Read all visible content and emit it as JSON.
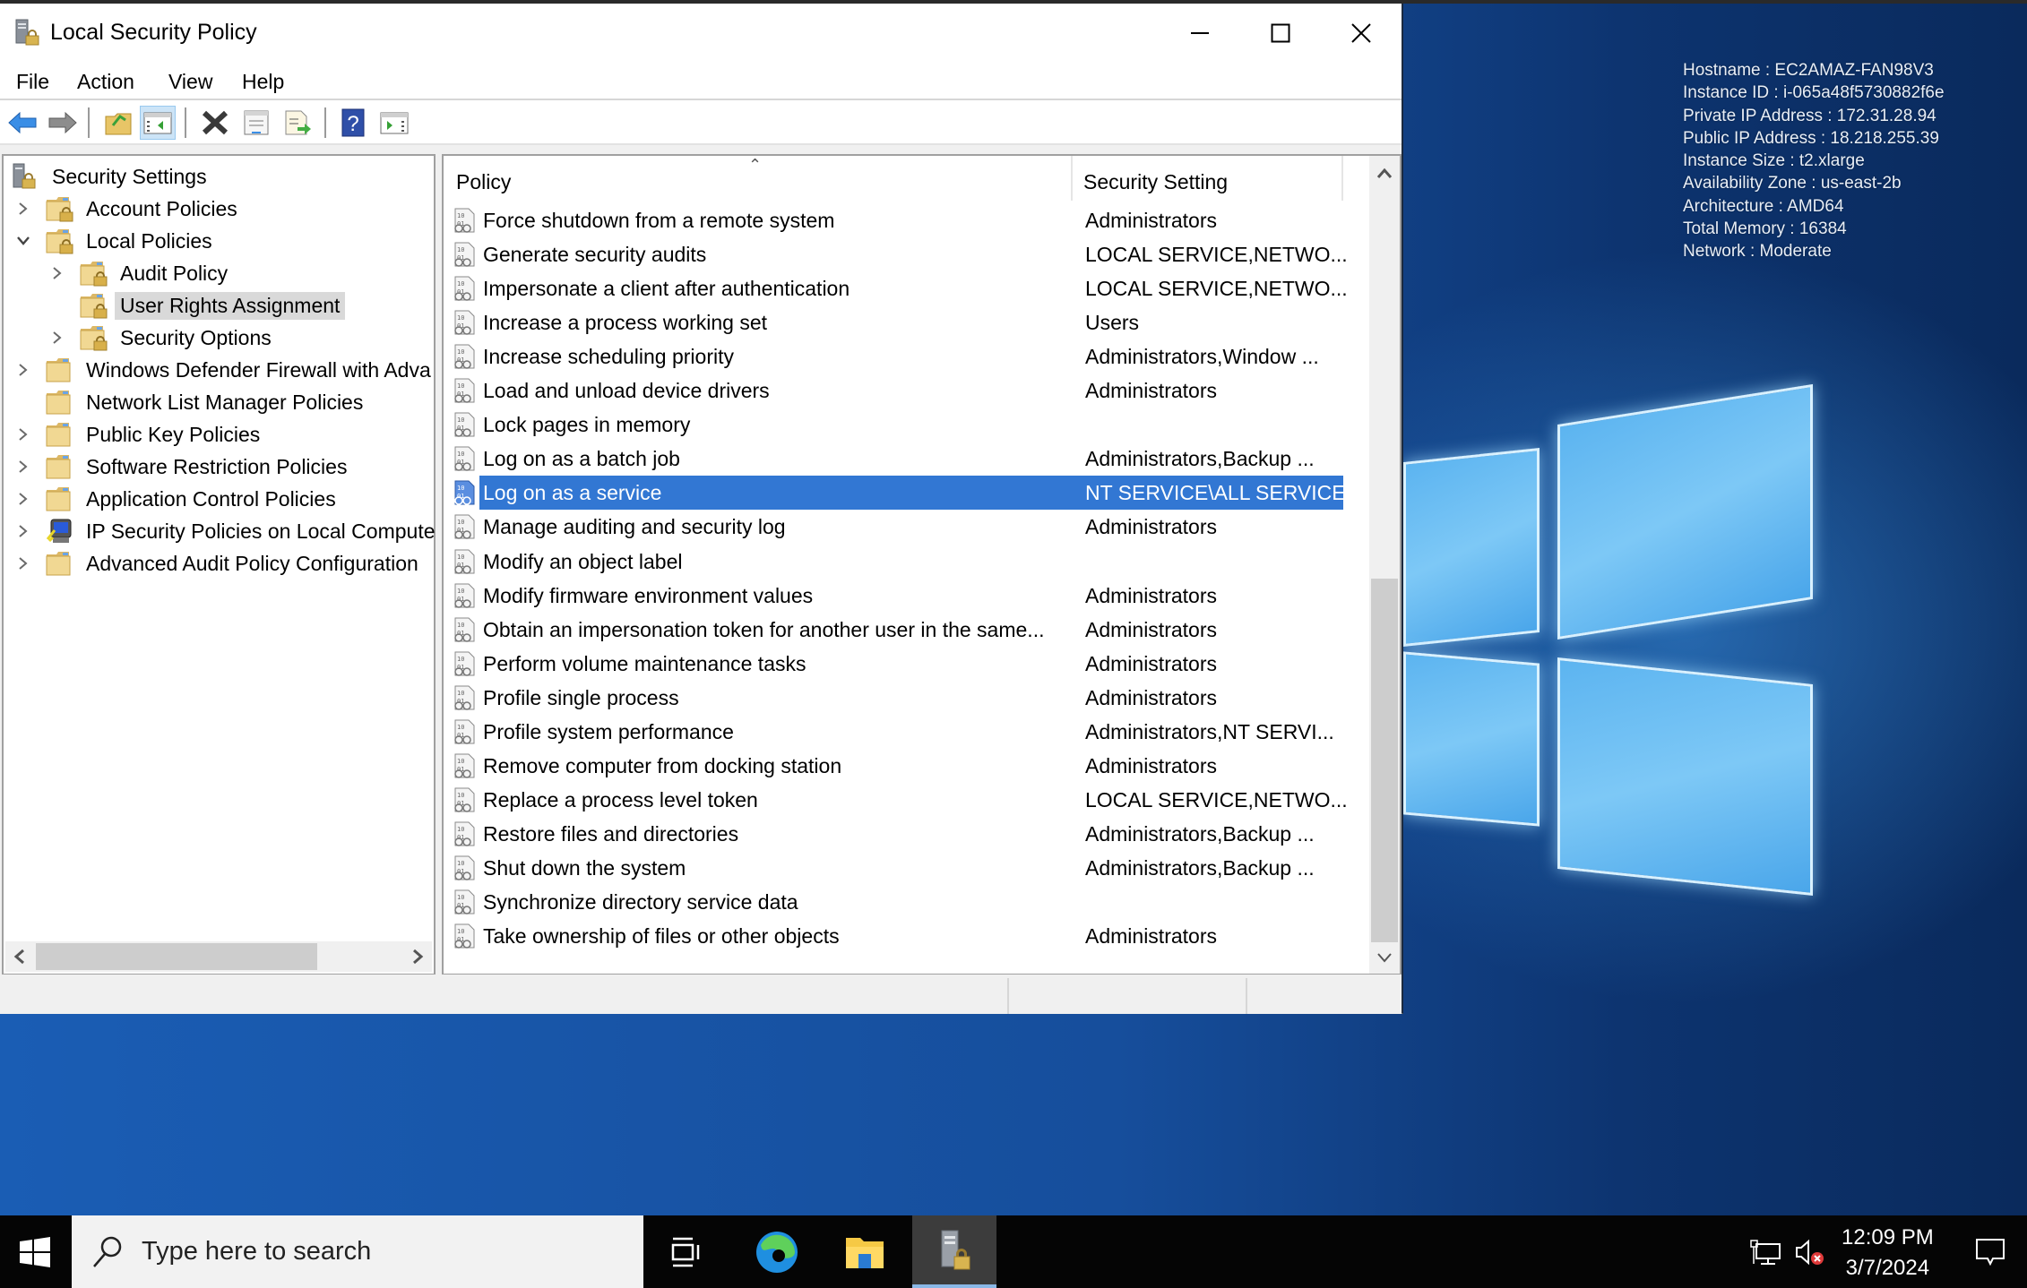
{
  "window": {
    "title": "Local Security Policy",
    "caption_buttons": [
      "minimize",
      "maximize",
      "close"
    ]
  },
  "menu": [
    "File",
    "Action",
    "View",
    "Help"
  ],
  "toolbar": {
    "buttons": [
      "back",
      "forward",
      "up-one-level",
      "show-hide-console-tree",
      "delete",
      "properties",
      "export-list",
      "help",
      "show-hide-action-pane"
    ]
  },
  "tree": {
    "root": "Security Settings",
    "items": [
      {
        "label": "Account Policies",
        "level": 1,
        "expander": "collapsed",
        "icon": "lock-folder"
      },
      {
        "label": "Local Policies",
        "level": 1,
        "expander": "expanded",
        "icon": "lock-folder"
      },
      {
        "label": "Audit Policy",
        "level": 2,
        "expander": "collapsed",
        "icon": "lock-folder"
      },
      {
        "label": "User Rights Assignment",
        "level": 2,
        "expander": "none",
        "icon": "lock-folder",
        "selected": true
      },
      {
        "label": "Security Options",
        "level": 2,
        "expander": "collapsed",
        "icon": "lock-folder"
      },
      {
        "label": "Windows Defender Firewall with Adva",
        "level": 1,
        "expander": "collapsed",
        "icon": "folder"
      },
      {
        "label": "Network List Manager Policies",
        "level": 1,
        "expander": "none",
        "icon": "folder"
      },
      {
        "label": "Public Key Policies",
        "level": 1,
        "expander": "collapsed",
        "icon": "folder"
      },
      {
        "label": "Software Restriction Policies",
        "level": 1,
        "expander": "collapsed",
        "icon": "folder"
      },
      {
        "label": "Application Control Policies",
        "level": 1,
        "expander": "collapsed",
        "icon": "folder"
      },
      {
        "label": "IP Security Policies on Local Compute",
        "level": 1,
        "expander": "collapsed",
        "icon": "ipsec"
      },
      {
        "label": "Advanced Audit Policy Configuration",
        "level": 1,
        "expander": "collapsed",
        "icon": "folder"
      }
    ]
  },
  "list": {
    "columns": [
      "Policy",
      "Security Setting"
    ],
    "sort_column": "Policy",
    "rows": [
      {
        "policy": "Force shutdown from a remote system",
        "setting": "Administrators"
      },
      {
        "policy": "Generate security audits",
        "setting": "LOCAL SERVICE,NETWO..."
      },
      {
        "policy": "Impersonate a client after authentication",
        "setting": "LOCAL SERVICE,NETWO..."
      },
      {
        "policy": "Increase a process working set",
        "setting": "Users"
      },
      {
        "policy": "Increase scheduling priority",
        "setting": "Administrators,Window ..."
      },
      {
        "policy": "Load and unload device drivers",
        "setting": "Administrators"
      },
      {
        "policy": "Lock pages in memory",
        "setting": ""
      },
      {
        "policy": "Log on as a batch job",
        "setting": "Administrators,Backup ..."
      },
      {
        "policy": "Log on as a service",
        "setting": "NT SERVICE\\ALL SERVICES",
        "selected": true
      },
      {
        "policy": "Manage auditing and security log",
        "setting": "Administrators"
      },
      {
        "policy": "Modify an object label",
        "setting": ""
      },
      {
        "policy": "Modify firmware environment values",
        "setting": "Administrators"
      },
      {
        "policy": "Obtain an impersonation token for another user in the same...",
        "setting": "Administrators"
      },
      {
        "policy": "Perform volume maintenance tasks",
        "setting": "Administrators"
      },
      {
        "policy": "Profile single process",
        "setting": "Administrators"
      },
      {
        "policy": "Profile system performance",
        "setting": "Administrators,NT SERVI..."
      },
      {
        "policy": "Remove computer from docking station",
        "setting": "Administrators"
      },
      {
        "policy": "Replace a process level token",
        "setting": "LOCAL SERVICE,NETWO..."
      },
      {
        "policy": "Restore files and directories",
        "setting": "Administrators,Backup ..."
      },
      {
        "policy": "Shut down the system",
        "setting": "Administrators,Backup ..."
      },
      {
        "policy": "Synchronize directory service data",
        "setting": ""
      },
      {
        "policy": "Take ownership of files or other objects",
        "setting": "Administrators"
      }
    ]
  },
  "desktop_info": [
    "Hostname : EC2AMAZ-FAN98V3",
    "Instance ID : i-065a48f5730882f6e",
    "Private IP Address : 172.31.28.94",
    "Public IP Address : 18.218.255.39",
    "Instance Size : t2.xlarge",
    "Availability Zone : us-east-2b",
    "Architecture : AMD64",
    "Total Memory : 16384",
    "Network : Moderate"
  ],
  "taskbar": {
    "search_placeholder": "Type here to search",
    "apps": [
      "task-view",
      "edge",
      "file-explorer",
      "local-security-policy"
    ],
    "active_app": "local-security-policy",
    "time": "12:09 PM",
    "date": "3/7/2024"
  },
  "colors": {
    "selection": "#3277d3",
    "tree_selection": "#d9d9d9",
    "taskbar": "#050505"
  }
}
